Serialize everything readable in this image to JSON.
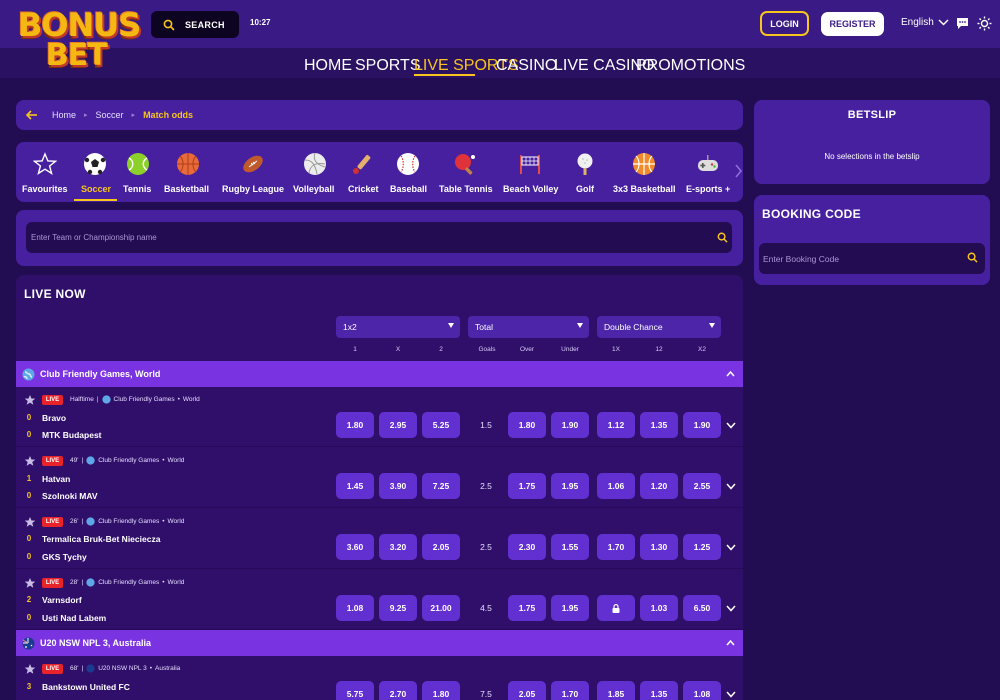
{
  "header": {
    "logo_line1": "BONUS",
    "logo_line2": "BET",
    "search_label": "SEARCH",
    "clock": "10:27",
    "login_label": "LOGIN",
    "register_label": "REGISTER",
    "language": "English"
  },
  "nav": {
    "items": [
      "HOME",
      "SPORTS",
      "LIVE SPORTS",
      "CASINO",
      "LIVE CASINO",
      "PROMOTIONS"
    ],
    "active": "LIVE SPORTS"
  },
  "breadcrumb": {
    "items": [
      "Home",
      "Soccer"
    ],
    "current": "Match odds"
  },
  "sports_tabs": [
    {
      "label": "Favourites",
      "icon": "star-icon"
    },
    {
      "label": "Soccer",
      "icon": "soccer-ball-icon",
      "active": true
    },
    {
      "label": "Tennis",
      "icon": "tennis-ball-icon"
    },
    {
      "label": "Basketball",
      "icon": "basketball-icon"
    },
    {
      "label": "Rugby League",
      "icon": "rugby-ball-icon"
    },
    {
      "label": "Volleyball",
      "icon": "volleyball-icon"
    },
    {
      "label": "Cricket",
      "icon": "cricket-bat-icon"
    },
    {
      "label": "Baseball",
      "icon": "baseball-icon"
    },
    {
      "label": "Table Tennis",
      "icon": "table-tennis-paddle-icon"
    },
    {
      "label": "Beach Volley",
      "icon": "beach-volley-net-icon"
    },
    {
      "label": "Golf",
      "icon": "golf-ball-icon"
    },
    {
      "label": "3x3 Basketball",
      "icon": "basketball-3x3-icon"
    },
    {
      "label": "E-sports +",
      "icon": "gamepad-icon"
    }
  ],
  "team_search": {
    "placeholder": "Enter Team or Championship name"
  },
  "live": {
    "title": "LIVE NOW",
    "markets": [
      {
        "selected": "1x2",
        "columns": [
          "1",
          "X",
          "2"
        ]
      },
      {
        "selected": "Total",
        "columns": [
          "Goals",
          "Over",
          "Under"
        ]
      },
      {
        "selected": "Double Chance",
        "columns": [
          "1X",
          "12",
          "X2"
        ]
      }
    ],
    "leagues": [
      {
        "name": "Club Friendly Games, World",
        "flag": "world-globe-icon",
        "matches": [
          {
            "live": "LIVE",
            "time": "Halftime",
            "league": "Club Friendly Games",
            "region": "World",
            "home": "Bravo",
            "away": "MTK Budapest",
            "home_score": "0",
            "away_score": "0",
            "odds": [
              "1.80",
              "2.95",
              "5.25"
            ],
            "goals": "1.5",
            "total": [
              "1.80",
              "1.90"
            ],
            "dc": [
              "1.12",
              "1.35",
              "1.90"
            ]
          },
          {
            "live": "LIVE",
            "time": "49'",
            "league": "Club Friendly Games",
            "region": "World",
            "home": "Hatvan",
            "away": "Szolnoki MAV",
            "home_score": "1",
            "away_score": "0",
            "odds": [
              "1.45",
              "3.90",
              "7.25"
            ],
            "goals": "2.5",
            "total": [
              "1.75",
              "1.95"
            ],
            "dc": [
              "1.06",
              "1.20",
              "2.55"
            ]
          },
          {
            "live": "LIVE",
            "time": "26'",
            "league": "Club Friendly Games",
            "region": "World",
            "home": "Termalica Bruk-Bet Nieciecza",
            "away": "GKS Tychy",
            "home_score": "0",
            "away_score": "0",
            "odds": [
              "3.60",
              "3.20",
              "2.05"
            ],
            "goals": "2.5",
            "total": [
              "2.30",
              "1.55"
            ],
            "dc": [
              "1.70",
              "1.30",
              "1.25"
            ]
          },
          {
            "live": "LIVE",
            "time": "28'",
            "league": "Club Friendly Games",
            "region": "World",
            "home": "Varnsdorf",
            "away": "Usti Nad Labem",
            "home_score": "2",
            "away_score": "0",
            "odds": [
              "1.08",
              "9.25",
              "21.00"
            ],
            "goals": "4.5",
            "total": [
              "1.75",
              "1.95"
            ],
            "dc": [
              "locked",
              "1.03",
              "6.50"
            ]
          }
        ]
      },
      {
        "name": "U20 NSW NPL 3, Australia",
        "flag": "australia-flag-icon",
        "matches": [
          {
            "live": "LIVE",
            "time": "68'",
            "league": "U20 NSW NPL 3",
            "region": "Australia",
            "home": "Bankstown United FC",
            "away": "",
            "home_score": "3",
            "away_score": "",
            "odds": [
              "5.75",
              "2.70",
              "1.80"
            ],
            "goals": "7.5",
            "total": [
              "2.05",
              "1.70"
            ],
            "dc": [
              "1.85",
              "1.35",
              "1.08"
            ]
          }
        ]
      }
    ]
  },
  "betslip": {
    "title": "BETSLIP",
    "empty_text": "No selections in the betslip"
  },
  "booking": {
    "title": "BOOKING CODE",
    "placeholder": "Enter Booking Code"
  },
  "colors": {
    "accent": "#f7c51c",
    "bg": "#230d52",
    "panel": "#4720a0",
    "odd_button": "#6230d1",
    "league_bar": "#7a33e0",
    "live_badge": "#e8232a"
  }
}
